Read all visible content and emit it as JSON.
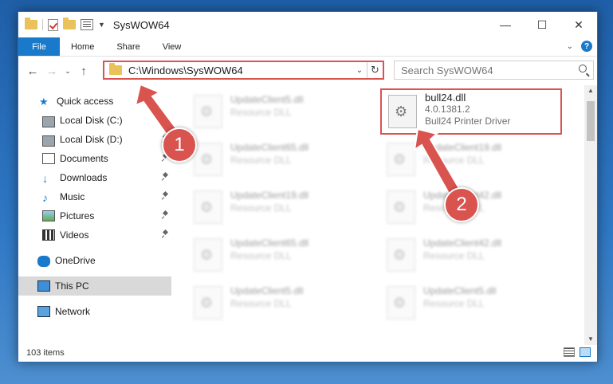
{
  "window": {
    "title": "SysWOW64"
  },
  "ribbon": {
    "tabs": [
      "File",
      "Home",
      "Share",
      "View"
    ]
  },
  "address": {
    "path": "C:\\Windows\\SysWOW64"
  },
  "search": {
    "placeholder": "Search SysWOW64"
  },
  "sidebar": {
    "items": [
      {
        "label": "Quick access",
        "icon": "star-icon"
      },
      {
        "label": "Local Disk (C:)",
        "icon": "disk-icon"
      },
      {
        "label": "Local Disk (D:)",
        "icon": "disk-icon"
      },
      {
        "label": "Documents",
        "icon": "documents-icon"
      },
      {
        "label": "Downloads",
        "icon": "downloads-icon"
      },
      {
        "label": "Music",
        "icon": "music-icon"
      },
      {
        "label": "Pictures",
        "icon": "pictures-icon"
      },
      {
        "label": "Videos",
        "icon": "videos-icon"
      },
      {
        "label": "OneDrive",
        "icon": "onedrive-icon"
      },
      {
        "label": "This PC",
        "icon": "this-pc-icon"
      },
      {
        "label": "Network",
        "icon": "network-icon"
      }
    ]
  },
  "files": [
    {
      "name": "UpdateClient5.dll",
      "desc": "Resource DLL"
    },
    {
      "name": "UpdateClient65.dll",
      "desc": "Resource DLL"
    },
    {
      "name": "UpdateClient19.dll",
      "desc": "Resource DLL"
    },
    {
      "name": "UpdateClient65.dll",
      "desc": "Resource DLL"
    },
    {
      "name": "UpdateClient5.dll",
      "desc": "Resource DLL"
    },
    {
      "name": "UpdateClient19.dll",
      "desc": "Resource DLL"
    },
    {
      "name": "UpdateClient42.dll",
      "desc": "Resource DLL"
    },
    {
      "name": "UpdateClient42.dll",
      "desc": "Resource DLL"
    },
    {
      "name": "UpdateClient5.dll",
      "desc": "Resource DLL"
    }
  ],
  "highlighted_file": {
    "name": "bull24.dll",
    "version": "4.0.1381.2",
    "desc": "Bull24 Printer Driver"
  },
  "status": {
    "item_count": "103 items"
  },
  "annotations": {
    "step1": "1",
    "step2": "2"
  },
  "colors": {
    "accent": "#1979ca",
    "annotation": "#d9534f"
  }
}
